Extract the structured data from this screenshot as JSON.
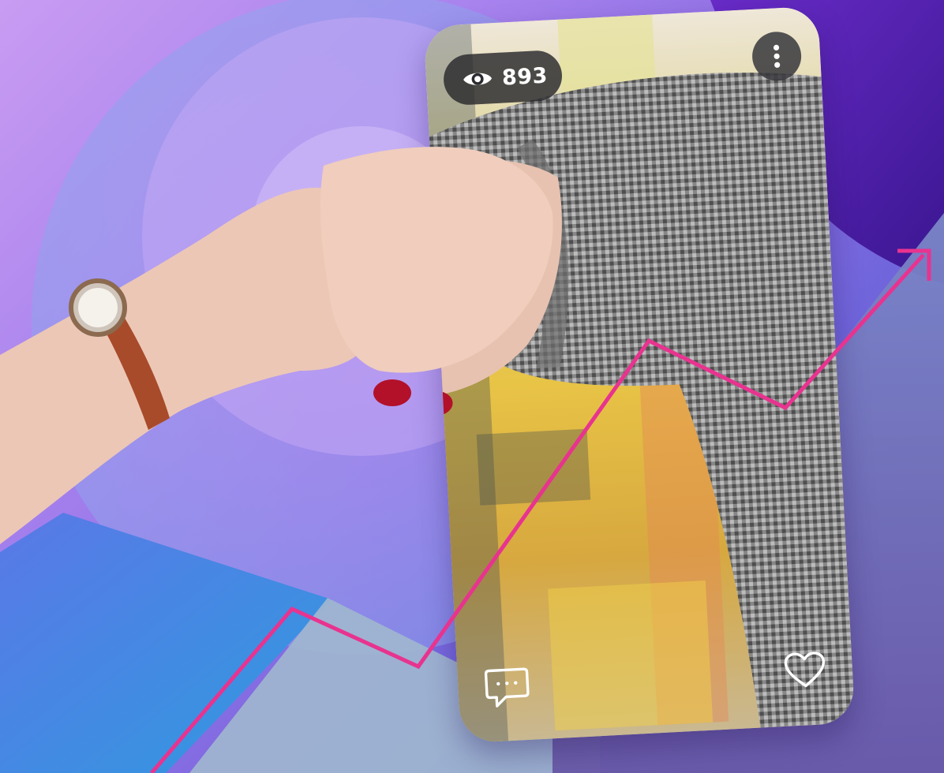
{
  "post": {
    "views_count": "893"
  },
  "icons": {
    "views": "eye-icon",
    "more": "more-vertical-icon",
    "comment": "comment-icon",
    "like": "heart-icon",
    "trend": "trend-arrow-icon"
  },
  "colors": {
    "background_violet": "#a883ee",
    "background_blue": "#3c8fe0",
    "background_deep_purple": "#4b1fa0",
    "trend_line": "#e8338f",
    "pill_background": "#28282c",
    "icon_color": "#ffffff"
  }
}
